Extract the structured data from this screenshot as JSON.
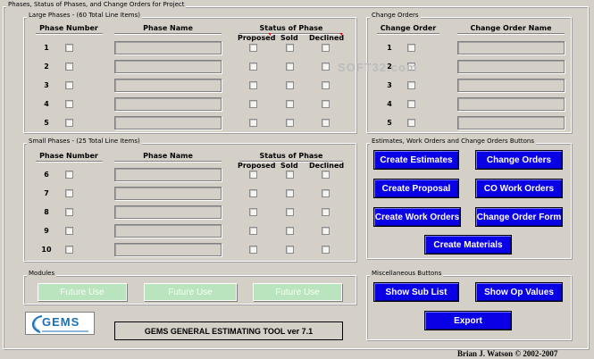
{
  "page": {
    "title": "Phases, Status of Phases, and Change Orders for Project"
  },
  "large_phases": {
    "legend": "Large Phases - (60 Total Line Items)",
    "col_number": "Phase Number",
    "col_name": "Phase Name",
    "col_status": "Status of Phase",
    "status_proposed": "Proposed",
    "status_sold": "Sold",
    "status_declined": "Declined",
    "rows": [
      "1",
      "2",
      "3",
      "4",
      "5"
    ]
  },
  "small_phases": {
    "legend": "Small Phases - (25 Total Line Items)",
    "col_number": "Phase Number",
    "col_name": "Phase Name",
    "col_status": "Status of Phase",
    "status_proposed": "Proposed",
    "status_sold": "Sold",
    "status_declined": "Declined",
    "rows": [
      "6",
      "7",
      "8",
      "9",
      "10"
    ]
  },
  "change_orders": {
    "legend": "Change Orders",
    "col_number": "Change Order",
    "col_name": "Change Order Name",
    "rows": [
      "1",
      "2",
      "3",
      "4",
      "5"
    ]
  },
  "estimates_group": {
    "legend": "Estimates, Work Orders and Change Orders Buttons",
    "create_estimates": "Create Estimates",
    "change_orders": "Change Orders",
    "create_proposal": "Create Proposal",
    "co_work_orders": "CO Work Orders",
    "create_work_orders": "Create Work Orders",
    "change_order_form": "Change Order Form",
    "create_materials": "Create Materials"
  },
  "modules": {
    "legend": "Modules",
    "future_use": "Future Use"
  },
  "misc": {
    "legend": "Miscellaneous Buttons",
    "show_sub_list": "Show Sub List",
    "show_op_values": "Show Op Values",
    "export": "Export"
  },
  "footer": {
    "logo_text": "GEMS",
    "tool_name": "GEMS GENERAL ESTIMATING TOOL ver 7.1",
    "copyright": "Brian J. Watson © 2002-2007"
  },
  "watermark": "SOFT32.com",
  "colors": {
    "button_blue": "#0a00e6",
    "future_green": "#b9e4bd",
    "background": "#d4d0c8"
  }
}
